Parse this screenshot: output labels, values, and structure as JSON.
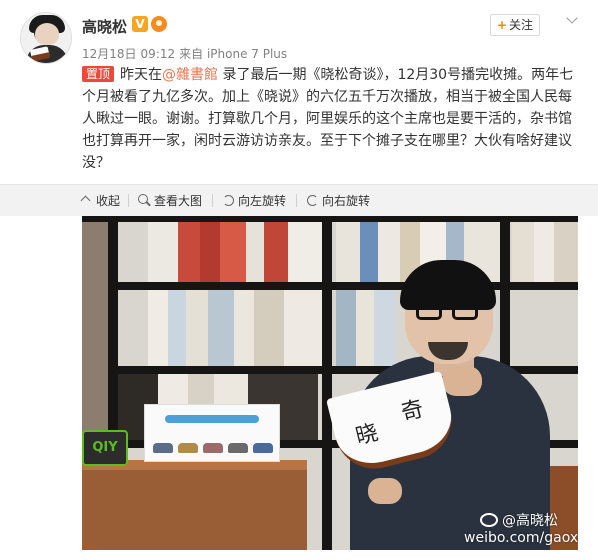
{
  "author": {
    "name": "高晓松",
    "verified_badge": "V"
  },
  "meta": {
    "date": "12月18日",
    "time": "09:12",
    "source": "来自 iPhone 7 Plus"
  },
  "follow_button": {
    "plus": "+",
    "label": "关注"
  },
  "post": {
    "pin_label": "置顶",
    "text_before": "昨天在",
    "mention": "@雜書館",
    "text_after": " 录了最后一期《晓松奇谈》，12月30号播完收摊。两年七个月被看了九亿多次。加上《晓说》的六亿五千万次播放，相当于被全国人民每人瞅过一眼。谢谢。打算歇几个月，阿里娱乐的这个主席也是要干活的，杂书馆也打算再开一家，闲时云游访访亲友。至于下个摊子支在哪里？大伙有啥好建议没？"
  },
  "toolbar": {
    "collapse": "收起",
    "view_large": "查看大图",
    "rotate_left": "向左旋转",
    "rotate_right": "向右旋转"
  },
  "photo": {
    "iqiyi": "QIY",
    "fan_text_1": "晓",
    "fan_text_2": "奇",
    "watermark_user": "@高晓松",
    "watermark_url": "weibo.com/gaoxiaosong"
  },
  "colors": {
    "pin_red": "#eb4a3a",
    "mention_orange": "#eb7350",
    "follow_plus": "#ff8200",
    "toolbar_bg": "#f2f2f2"
  },
  "icons": [
    "collapse-icon",
    "zoom-icon",
    "rotate-left-icon",
    "rotate-right-icon",
    "chevron-down-icon",
    "verified-icon",
    "vip-icon"
  ]
}
